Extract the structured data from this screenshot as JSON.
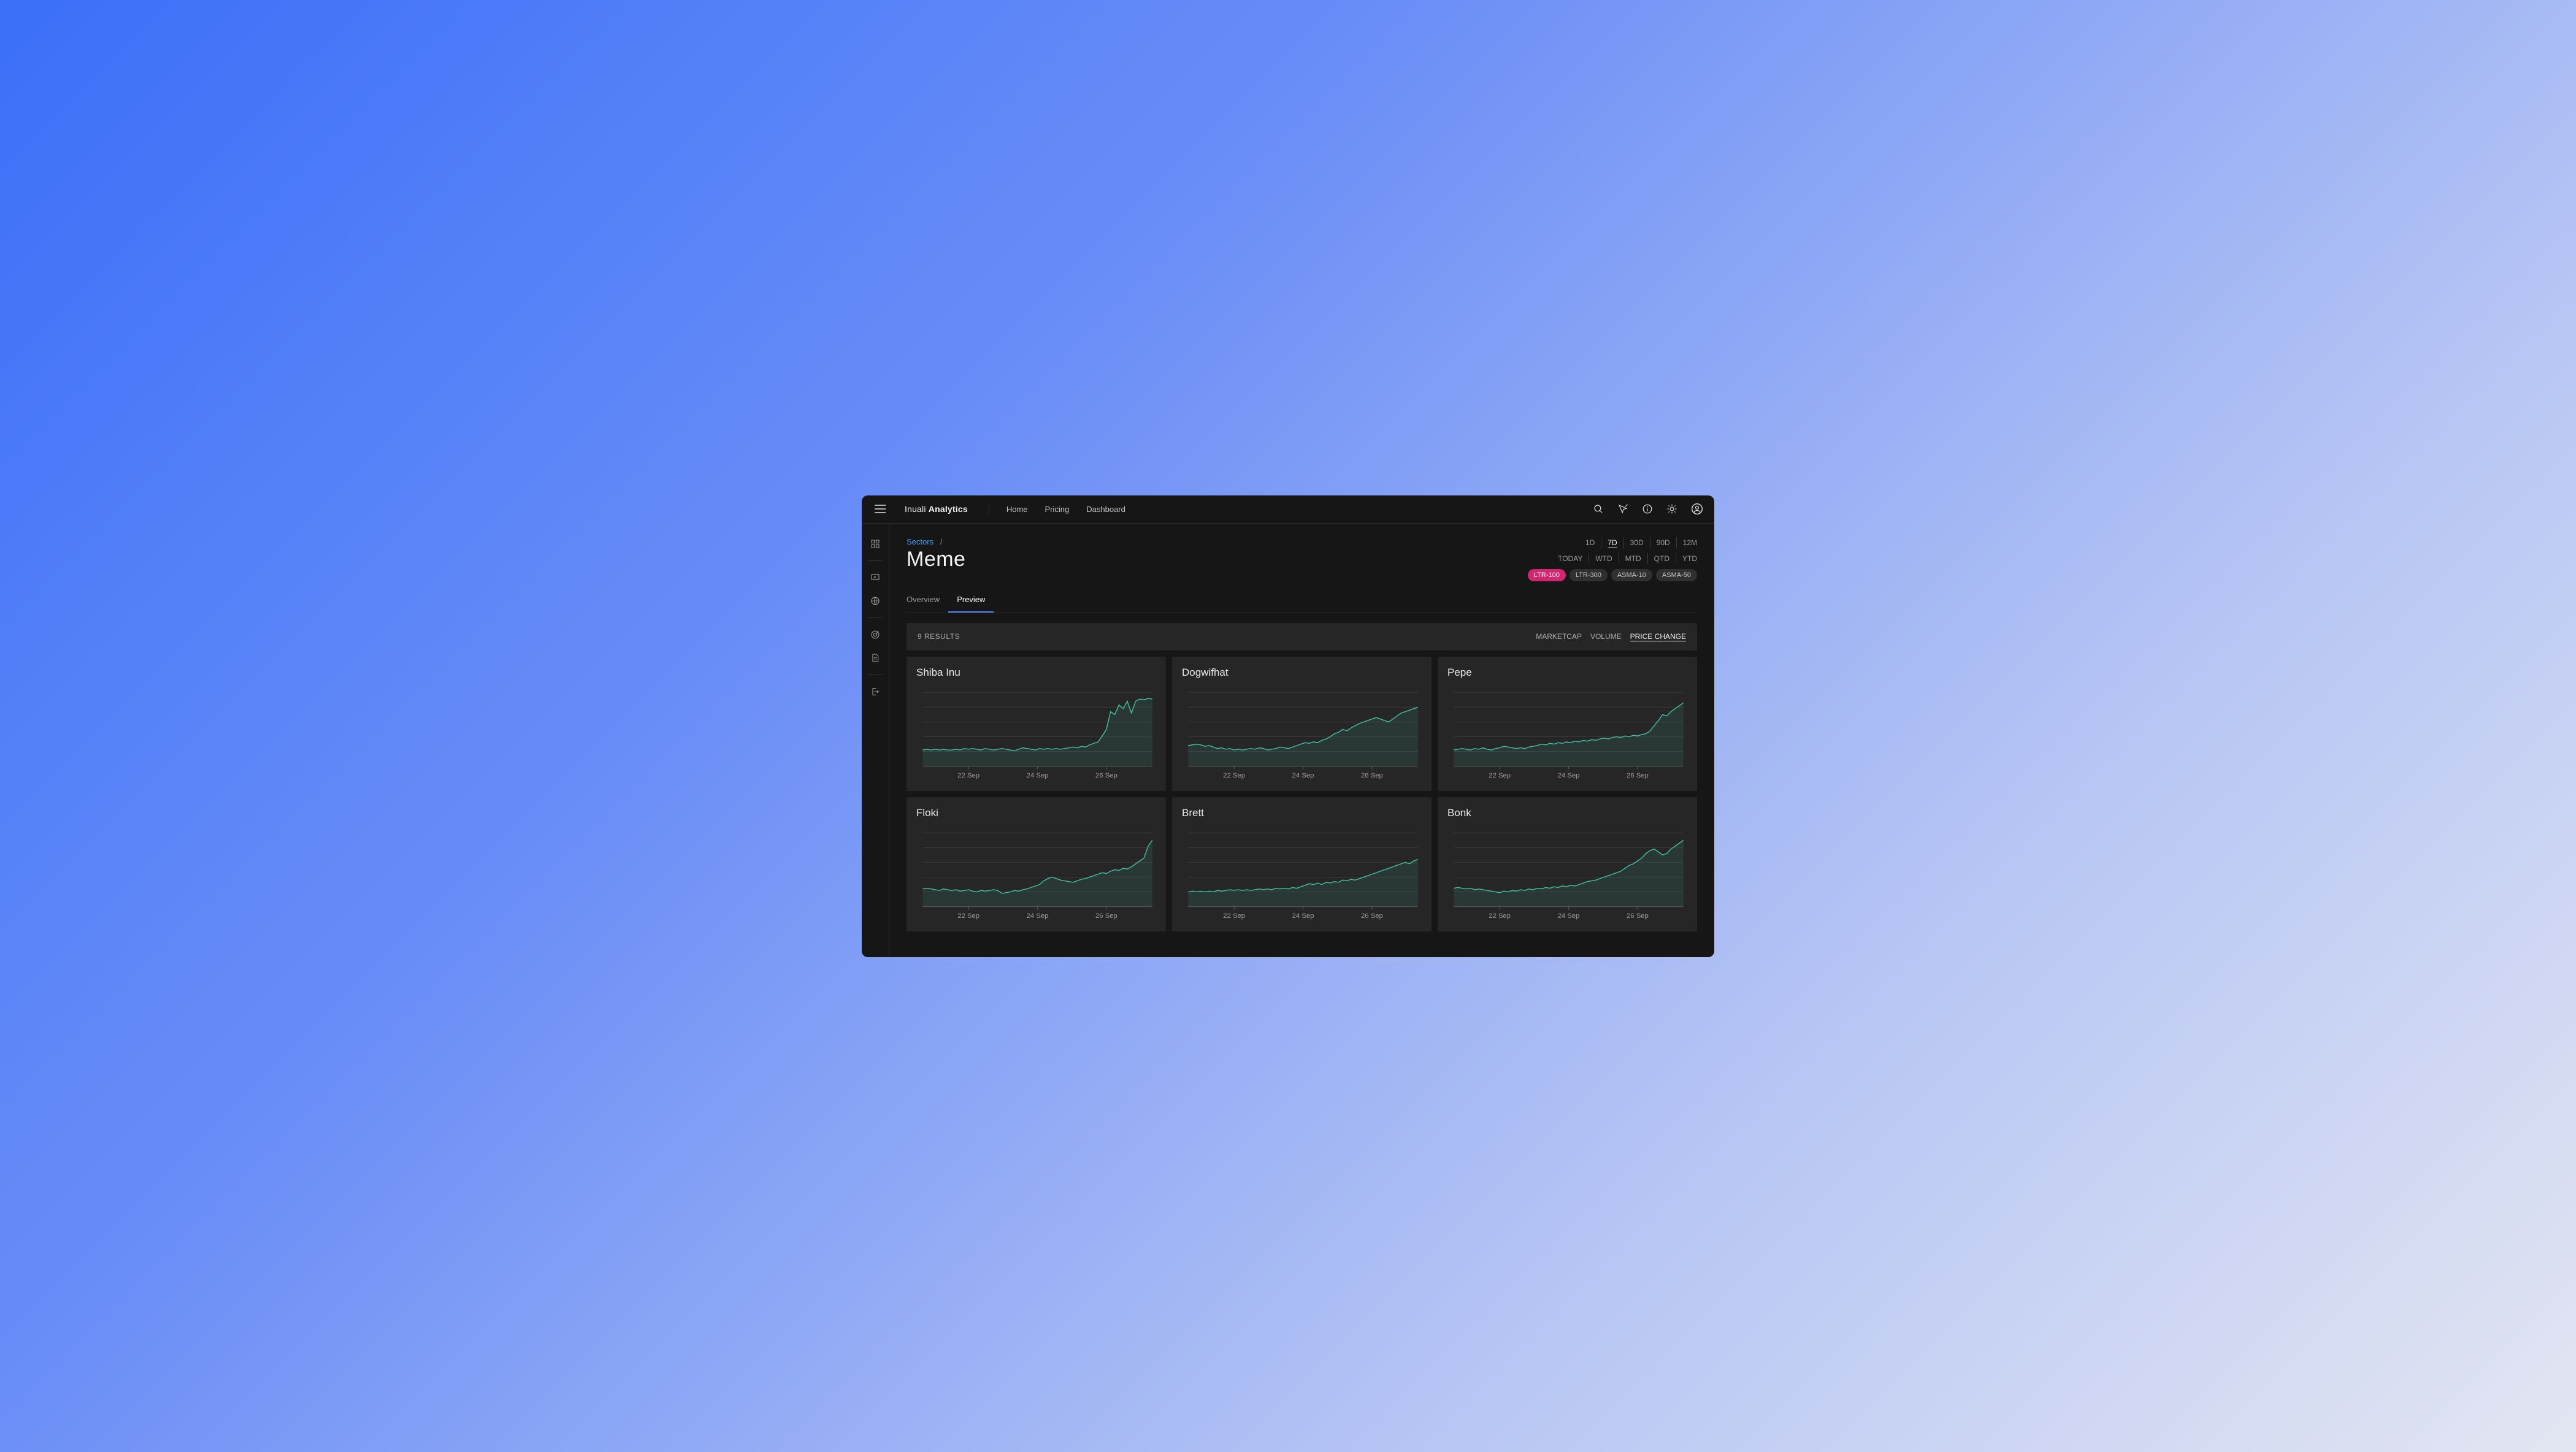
{
  "brand": {
    "light": "Inuali ",
    "bold": "Analytics"
  },
  "nav": {
    "home": "Home",
    "pricing": "Pricing",
    "dashboard": "Dashboard"
  },
  "breadcrumb": {
    "root": "Sectors",
    "sep": "/"
  },
  "page_title": "Meme",
  "tabs": {
    "overview": "Overview",
    "preview": "Preview"
  },
  "ranges_top": [
    "1D",
    "7D",
    "30D",
    "90D",
    "12M"
  ],
  "ranges_bottom": [
    "TODAY",
    "WTD",
    "MTD",
    "QTD",
    "YTD"
  ],
  "range_active": "7D",
  "pills": [
    "LTR-100",
    "LTR-300",
    "ASMA-10",
    "ASMA-50"
  ],
  "pill_active": "LTR-100",
  "toolbar": {
    "results": "9 RESULTS"
  },
  "sorters": [
    "MARKETCAP",
    "VOLUME",
    "PRICE CHANGE"
  ],
  "sorter_active": "PRICE CHANGE",
  "chart_x_ticks": [
    "22 Sep",
    "24 Sep",
    "26 Sep"
  ],
  "chart_data": [
    {
      "type": "line",
      "title": "Shiba Inu",
      "ylim": [
        0,
        100
      ],
      "values": [
        22,
        23,
        22,
        23,
        22,
        23,
        22,
        22,
        23,
        22,
        24,
        23,
        24,
        23,
        22,
        24,
        23,
        22,
        23,
        24,
        23,
        22,
        21,
        23,
        25,
        24,
        23,
        22,
        24,
        23,
        24,
        23,
        24,
        23,
        24,
        25,
        26,
        25,
        27,
        26,
        29,
        31,
        33,
        41,
        50,
        74,
        70,
        83,
        78,
        88,
        72,
        88,
        91,
        90,
        92,
        91
      ]
    },
    {
      "type": "line",
      "title": "Dogwifhat",
      "ylim": [
        0,
        100
      ],
      "values": [
        28,
        29,
        30,
        29,
        27,
        28,
        26,
        24,
        25,
        23,
        24,
        22,
        23,
        22,
        23,
        24,
        23,
        25,
        24,
        22,
        23,
        24,
        26,
        25,
        24,
        26,
        28,
        30,
        32,
        31,
        33,
        32,
        35,
        37,
        40,
        44,
        46,
        50,
        48,
        52,
        55,
        58,
        60,
        62,
        64,
        66,
        64,
        62,
        60,
        64,
        68,
        72,
        74,
        76,
        78,
        80
      ]
    },
    {
      "type": "line",
      "title": "Pepe",
      "ylim": [
        0,
        100
      ],
      "values": [
        22,
        23,
        24,
        23,
        22,
        24,
        23,
        25,
        23,
        22,
        24,
        25,
        27,
        26,
        25,
        24,
        25,
        24,
        26,
        27,
        28,
        30,
        29,
        31,
        30,
        32,
        31,
        33,
        32,
        34,
        33,
        35,
        34,
        36,
        35,
        37,
        38,
        37,
        39,
        40,
        39,
        41,
        40,
        42,
        41,
        43,
        44,
        48,
        55,
        62,
        70,
        68,
        74,
        78,
        82,
        86
      ]
    },
    {
      "type": "line",
      "title": "Floki",
      "ylim": [
        0,
        100
      ],
      "values": [
        24,
        25,
        24,
        23,
        22,
        24,
        23,
        22,
        23,
        21,
        22,
        23,
        21,
        20,
        22,
        21,
        22,
        23,
        22,
        18,
        19,
        20,
        22,
        21,
        23,
        24,
        26,
        28,
        30,
        35,
        38,
        40,
        38,
        36,
        35,
        34,
        33,
        35,
        37,
        38,
        40,
        42,
        44,
        46,
        45,
        48,
        50,
        49,
        52,
        51,
        54,
        58,
        62,
        66,
        82,
        90
      ]
    },
    {
      "type": "line",
      "title": "Brett",
      "ylim": [
        0,
        100
      ],
      "values": [
        20,
        21,
        20,
        21,
        20,
        21,
        20,
        22,
        21,
        22,
        23,
        22,
        23,
        22,
        23,
        22,
        23,
        24,
        23,
        24,
        23,
        25,
        24,
        25,
        24,
        26,
        25,
        27,
        29,
        31,
        30,
        32,
        30,
        33,
        32,
        34,
        33,
        36,
        35,
        37,
        36,
        38,
        40,
        42,
        44,
        46,
        48,
        50,
        52,
        54,
        56,
        58,
        60,
        58,
        62,
        64
      ]
    },
    {
      "type": "line",
      "title": "Bonk",
      "ylim": [
        0,
        100
      ],
      "values": [
        25,
        26,
        25,
        24,
        25,
        23,
        24,
        23,
        22,
        21,
        20,
        19,
        21,
        20,
        22,
        21,
        23,
        22,
        24,
        23,
        25,
        24,
        26,
        25,
        27,
        26,
        28,
        27,
        29,
        28,
        30,
        32,
        34,
        35,
        36,
        38,
        40,
        42,
        44,
        46,
        48,
        52,
        56,
        58,
        62,
        66,
        72,
        76,
        78,
        74,
        70,
        72,
        78,
        82,
        86,
        90
      ]
    }
  ]
}
